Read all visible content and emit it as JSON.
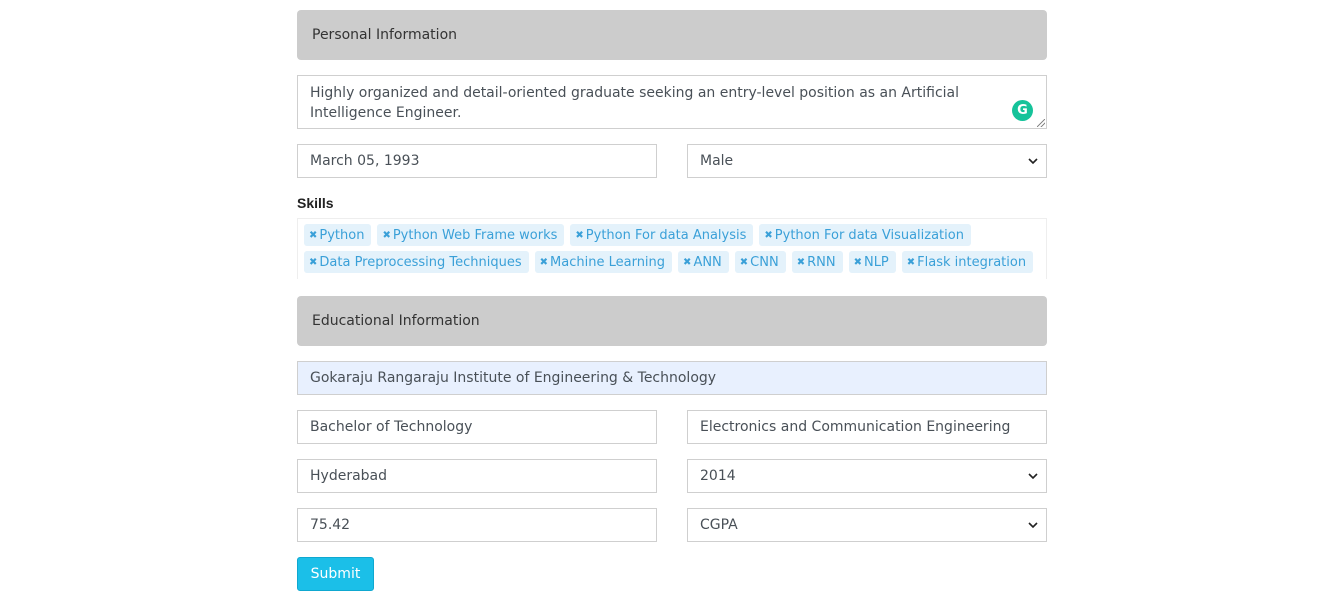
{
  "personal": {
    "header": "Personal Information",
    "summary": "Highly organized and detail-oriented graduate seeking an entry-level position as an Artificial Intelligence Engineer.",
    "dob": "March 05, 1993",
    "gender": "Male",
    "skills_label": "Skills",
    "skills": [
      "Python",
      "Python Web Frame works",
      "Python For data Analysis",
      "Python For data Visualization",
      "Data Preprocessing Techniques",
      "Machine Learning",
      "ANN",
      "CNN",
      "RNN",
      "NLP",
      "Flask integration"
    ]
  },
  "education": {
    "header": "Educational Information",
    "institute": "Gokaraju Rangaraju Institute of Engineering & Technology",
    "degree": "Bachelor of Technology",
    "branch": "Electronics and Communication Engineering",
    "city": "Hyderabad",
    "year": "2014",
    "score": "75.42",
    "score_type": "CGPA"
  },
  "submit_label": "Submit",
  "icons": {
    "grammarly": "grammarly-icon",
    "remove": "close-icon",
    "select": "chevron-down-icon"
  },
  "colors": {
    "header_bg": "#cccccc",
    "tag_bg": "#e4f2fb",
    "tag_text": "#3aa0d8",
    "submit_bg": "#1bbfe8",
    "autofill_bg": "#e8f0fe"
  }
}
